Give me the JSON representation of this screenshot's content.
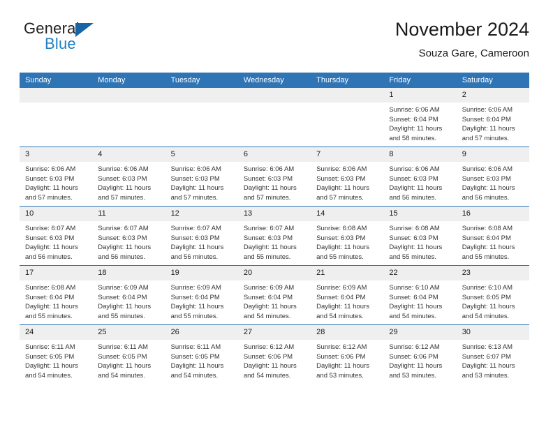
{
  "brand": {
    "name_part1": "General",
    "name_part2": "Blue",
    "accent_color": "#1f7fc4",
    "triangle_color": "#1565a8"
  },
  "header": {
    "title": "November 2024",
    "subtitle": "Souza Gare, Cameroon"
  },
  "calendar": {
    "header_bg": "#2f74b5",
    "daynum_bg": "#efefef",
    "weekdays": [
      "Sunday",
      "Monday",
      "Tuesday",
      "Wednesday",
      "Thursday",
      "Friday",
      "Saturday"
    ],
    "weeks": [
      [
        {
          "day": "",
          "sunrise": "",
          "sunset": "",
          "daylight1": "",
          "daylight2": ""
        },
        {
          "day": "",
          "sunrise": "",
          "sunset": "",
          "daylight1": "",
          "daylight2": ""
        },
        {
          "day": "",
          "sunrise": "",
          "sunset": "",
          "daylight1": "",
          "daylight2": ""
        },
        {
          "day": "",
          "sunrise": "",
          "sunset": "",
          "daylight1": "",
          "daylight2": ""
        },
        {
          "day": "",
          "sunrise": "",
          "sunset": "",
          "daylight1": "",
          "daylight2": ""
        },
        {
          "day": "1",
          "sunrise": "Sunrise: 6:06 AM",
          "sunset": "Sunset: 6:04 PM",
          "daylight1": "Daylight: 11 hours",
          "daylight2": "and 58 minutes."
        },
        {
          "day": "2",
          "sunrise": "Sunrise: 6:06 AM",
          "sunset": "Sunset: 6:04 PM",
          "daylight1": "Daylight: 11 hours",
          "daylight2": "and 57 minutes."
        }
      ],
      [
        {
          "day": "3",
          "sunrise": "Sunrise: 6:06 AM",
          "sunset": "Sunset: 6:03 PM",
          "daylight1": "Daylight: 11 hours",
          "daylight2": "and 57 minutes."
        },
        {
          "day": "4",
          "sunrise": "Sunrise: 6:06 AM",
          "sunset": "Sunset: 6:03 PM",
          "daylight1": "Daylight: 11 hours",
          "daylight2": "and 57 minutes."
        },
        {
          "day": "5",
          "sunrise": "Sunrise: 6:06 AM",
          "sunset": "Sunset: 6:03 PM",
          "daylight1": "Daylight: 11 hours",
          "daylight2": "and 57 minutes."
        },
        {
          "day": "6",
          "sunrise": "Sunrise: 6:06 AM",
          "sunset": "Sunset: 6:03 PM",
          "daylight1": "Daylight: 11 hours",
          "daylight2": "and 57 minutes."
        },
        {
          "day": "7",
          "sunrise": "Sunrise: 6:06 AM",
          "sunset": "Sunset: 6:03 PM",
          "daylight1": "Daylight: 11 hours",
          "daylight2": "and 57 minutes."
        },
        {
          "day": "8",
          "sunrise": "Sunrise: 6:06 AM",
          "sunset": "Sunset: 6:03 PM",
          "daylight1": "Daylight: 11 hours",
          "daylight2": "and 56 minutes."
        },
        {
          "day": "9",
          "sunrise": "Sunrise: 6:06 AM",
          "sunset": "Sunset: 6:03 PM",
          "daylight1": "Daylight: 11 hours",
          "daylight2": "and 56 minutes."
        }
      ],
      [
        {
          "day": "10",
          "sunrise": "Sunrise: 6:07 AM",
          "sunset": "Sunset: 6:03 PM",
          "daylight1": "Daylight: 11 hours",
          "daylight2": "and 56 minutes."
        },
        {
          "day": "11",
          "sunrise": "Sunrise: 6:07 AM",
          "sunset": "Sunset: 6:03 PM",
          "daylight1": "Daylight: 11 hours",
          "daylight2": "and 56 minutes."
        },
        {
          "day": "12",
          "sunrise": "Sunrise: 6:07 AM",
          "sunset": "Sunset: 6:03 PM",
          "daylight1": "Daylight: 11 hours",
          "daylight2": "and 56 minutes."
        },
        {
          "day": "13",
          "sunrise": "Sunrise: 6:07 AM",
          "sunset": "Sunset: 6:03 PM",
          "daylight1": "Daylight: 11 hours",
          "daylight2": "and 55 minutes."
        },
        {
          "day": "14",
          "sunrise": "Sunrise: 6:08 AM",
          "sunset": "Sunset: 6:03 PM",
          "daylight1": "Daylight: 11 hours",
          "daylight2": "and 55 minutes."
        },
        {
          "day": "15",
          "sunrise": "Sunrise: 6:08 AM",
          "sunset": "Sunset: 6:03 PM",
          "daylight1": "Daylight: 11 hours",
          "daylight2": "and 55 minutes."
        },
        {
          "day": "16",
          "sunrise": "Sunrise: 6:08 AM",
          "sunset": "Sunset: 6:04 PM",
          "daylight1": "Daylight: 11 hours",
          "daylight2": "and 55 minutes."
        }
      ],
      [
        {
          "day": "17",
          "sunrise": "Sunrise: 6:08 AM",
          "sunset": "Sunset: 6:04 PM",
          "daylight1": "Daylight: 11 hours",
          "daylight2": "and 55 minutes."
        },
        {
          "day": "18",
          "sunrise": "Sunrise: 6:09 AM",
          "sunset": "Sunset: 6:04 PM",
          "daylight1": "Daylight: 11 hours",
          "daylight2": "and 55 minutes."
        },
        {
          "day": "19",
          "sunrise": "Sunrise: 6:09 AM",
          "sunset": "Sunset: 6:04 PM",
          "daylight1": "Daylight: 11 hours",
          "daylight2": "and 55 minutes."
        },
        {
          "day": "20",
          "sunrise": "Sunrise: 6:09 AM",
          "sunset": "Sunset: 6:04 PM",
          "daylight1": "Daylight: 11 hours",
          "daylight2": "and 54 minutes."
        },
        {
          "day": "21",
          "sunrise": "Sunrise: 6:09 AM",
          "sunset": "Sunset: 6:04 PM",
          "daylight1": "Daylight: 11 hours",
          "daylight2": "and 54 minutes."
        },
        {
          "day": "22",
          "sunrise": "Sunrise: 6:10 AM",
          "sunset": "Sunset: 6:04 PM",
          "daylight1": "Daylight: 11 hours",
          "daylight2": "and 54 minutes."
        },
        {
          "day": "23",
          "sunrise": "Sunrise: 6:10 AM",
          "sunset": "Sunset: 6:05 PM",
          "daylight1": "Daylight: 11 hours",
          "daylight2": "and 54 minutes."
        }
      ],
      [
        {
          "day": "24",
          "sunrise": "Sunrise: 6:11 AM",
          "sunset": "Sunset: 6:05 PM",
          "daylight1": "Daylight: 11 hours",
          "daylight2": "and 54 minutes."
        },
        {
          "day": "25",
          "sunrise": "Sunrise: 6:11 AM",
          "sunset": "Sunset: 6:05 PM",
          "daylight1": "Daylight: 11 hours",
          "daylight2": "and 54 minutes."
        },
        {
          "day": "26",
          "sunrise": "Sunrise: 6:11 AM",
          "sunset": "Sunset: 6:05 PM",
          "daylight1": "Daylight: 11 hours",
          "daylight2": "and 54 minutes."
        },
        {
          "day": "27",
          "sunrise": "Sunrise: 6:12 AM",
          "sunset": "Sunset: 6:06 PM",
          "daylight1": "Daylight: 11 hours",
          "daylight2": "and 54 minutes."
        },
        {
          "day": "28",
          "sunrise": "Sunrise: 6:12 AM",
          "sunset": "Sunset: 6:06 PM",
          "daylight1": "Daylight: 11 hours",
          "daylight2": "and 53 minutes."
        },
        {
          "day": "29",
          "sunrise": "Sunrise: 6:12 AM",
          "sunset": "Sunset: 6:06 PM",
          "daylight1": "Daylight: 11 hours",
          "daylight2": "and 53 minutes."
        },
        {
          "day": "30",
          "sunrise": "Sunrise: 6:13 AM",
          "sunset": "Sunset: 6:07 PM",
          "daylight1": "Daylight: 11 hours",
          "daylight2": "and 53 minutes."
        }
      ]
    ]
  }
}
